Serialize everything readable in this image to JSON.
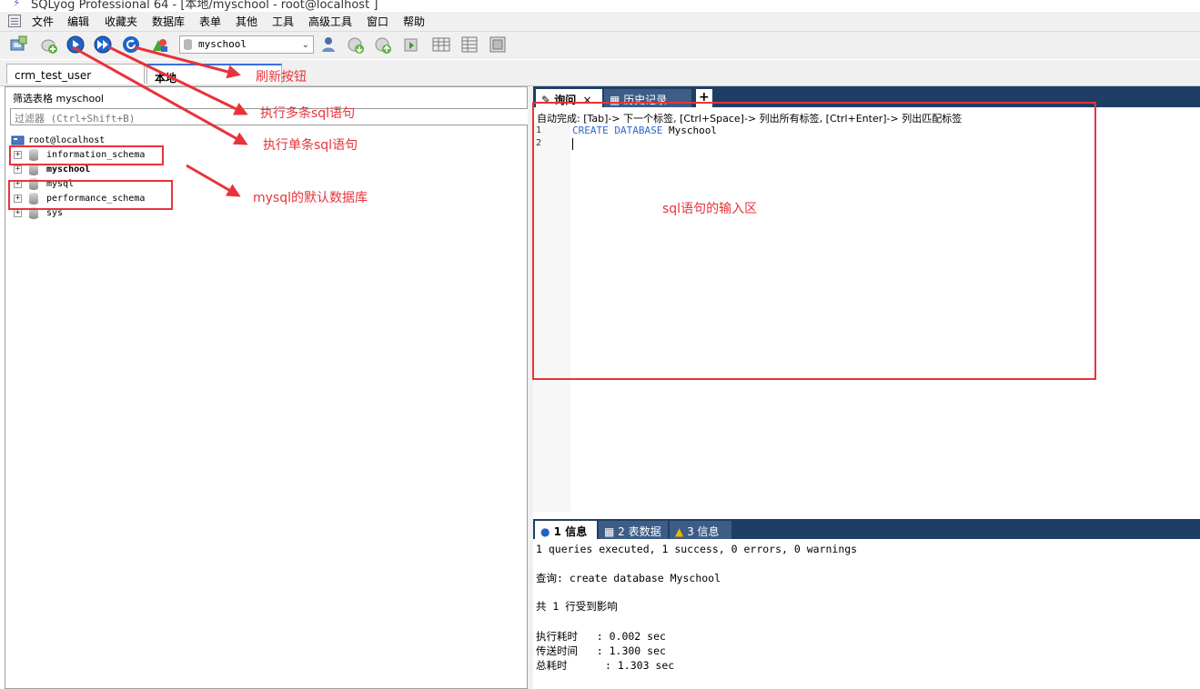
{
  "window": {
    "title": "SQLyog Professional 64 - [本地/myschool - root@localhost ]"
  },
  "menu": {
    "items": [
      "文件",
      "编辑",
      "收藏夹",
      "数据库",
      "表单",
      "其他",
      "工具",
      "高级工具",
      "窗口",
      "帮助"
    ]
  },
  "toolbar": {
    "database_selector": {
      "value": "myschool"
    },
    "icons": [
      "new-connection-icon",
      "new-connection-plus-icon",
      "execute-query-icon",
      "execute-all-queries-icon",
      "refresh-icon",
      "schema-designer-icon",
      "user-manager-icon",
      "backup-database-icon",
      "restore-database-icon",
      "import-icon",
      "table-data-icon",
      "table-structure-icon",
      "table-index-icon"
    ]
  },
  "connection_tabs": [
    {
      "label": "crm_test_user"
    },
    {
      "label": "本地"
    }
  ],
  "left_panel": {
    "filter_label": "筛选表格 myschool",
    "filter_placeholder": "过滤器 (Ctrl+Shift+B)",
    "root": "root@localhost",
    "databases": [
      {
        "name": "information_schema",
        "bold": false
      },
      {
        "name": "myschool",
        "bold": true
      },
      {
        "name": "mysql",
        "bold": false
      },
      {
        "name": "performance_schema",
        "bold": false
      },
      {
        "name": "sys",
        "bold": false
      }
    ]
  },
  "query_tabs": [
    {
      "label": "询问"
    },
    {
      "label": "历史记录"
    },
    {
      "label": "+"
    }
  ],
  "editor": {
    "hint": "自动完成: [Tab]-> 下一个标签, [Ctrl+Space]-> 列出所有标签, [Ctrl+Enter]-> 列出匹配标签",
    "lines": [
      "1",
      "2"
    ],
    "code_keyword_1": "CREATE",
    "code_keyword_2": "DATABASE",
    "code_identifier": "Myschool"
  },
  "result_tabs": [
    {
      "label": "1 信息"
    },
    {
      "label": "2 表数据"
    },
    {
      "label": "3 信息"
    }
  ],
  "results": {
    "line1": "1 queries executed, 1 success, 0 errors, 0 warnings",
    "line2": "查询: create database Myschool",
    "line3": "共 1 行受到影响",
    "line4": "执行耗时   : 0.002 sec",
    "line5": "传送时间   : 1.300 sec",
    "line6": "总耗时      : 1.303 sec"
  },
  "annotations": {
    "refresh": "刷新按钮",
    "exec_multi": "执行多条sql语句",
    "exec_single": "执行单条sql语句",
    "default_db": "mysql的默认数据库",
    "input_area": "sql语句的输入区"
  },
  "colors": {
    "annotation": "#e8333a",
    "tab_bar": "#1e3e66",
    "keyword": "#2a6acf"
  }
}
